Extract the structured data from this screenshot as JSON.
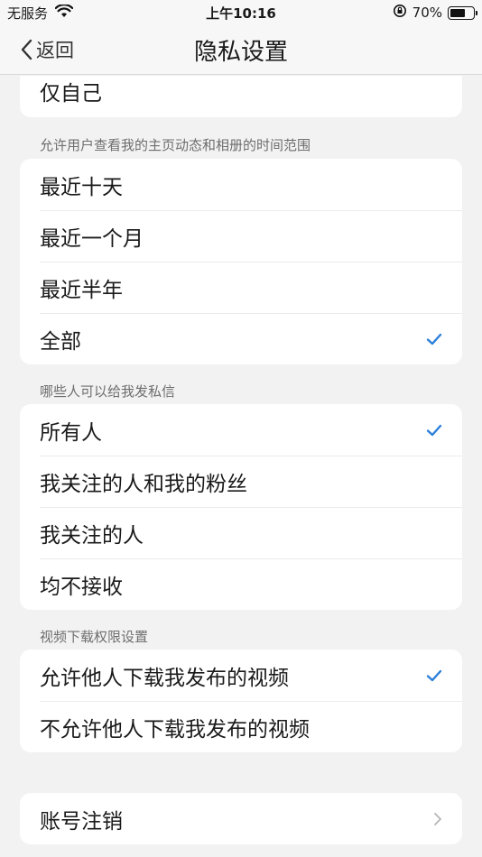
{
  "status_bar": {
    "carrier": "无服务",
    "time": "上午10:16",
    "battery_percent": "70%",
    "battery_level": 0.7
  },
  "nav": {
    "back_label": "返回",
    "title": "隐私设置"
  },
  "partial_section": {
    "items": [
      {
        "label": "仅自己"
      }
    ]
  },
  "time_range": {
    "header": "允许用户查看我的主页动态和相册的时间范围",
    "items": [
      {
        "label": "最近十天",
        "checked": false
      },
      {
        "label": "最近一个月",
        "checked": false
      },
      {
        "label": "最近半年",
        "checked": false
      },
      {
        "label": "全部",
        "checked": true
      }
    ]
  },
  "private_message": {
    "header": "哪些人可以给我发私信",
    "items": [
      {
        "label": "所有人",
        "checked": true
      },
      {
        "label": "我关注的人和我的粉丝",
        "checked": false
      },
      {
        "label": "我关注的人",
        "checked": false
      },
      {
        "label": "均不接收",
        "checked": false
      }
    ]
  },
  "video_download": {
    "header": "视频下载权限设置",
    "items": [
      {
        "label": "允许他人下载我发布的视频",
        "checked": true
      },
      {
        "label": "不允许他人下载我发布的视频",
        "checked": false
      }
    ]
  },
  "account": {
    "cancel_label": "账号注销"
  },
  "colors": {
    "accent": "#2b7fd9",
    "background": "#f2f2f2",
    "card": "#ffffff"
  }
}
